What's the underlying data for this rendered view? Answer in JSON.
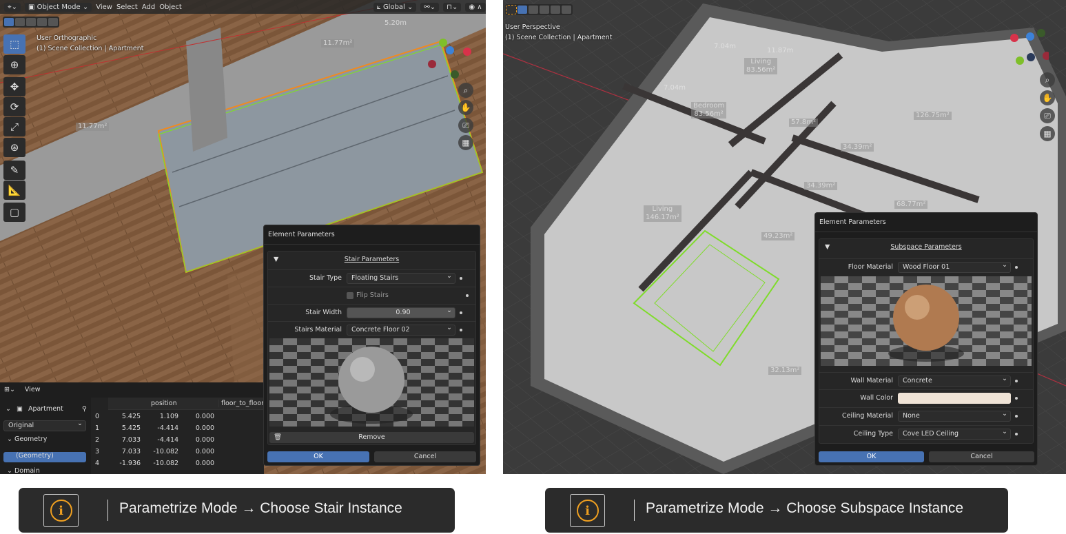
{
  "left": {
    "header": {
      "mode": "Object Mode",
      "menus": [
        "View",
        "Select",
        "Add",
        "Object"
      ],
      "orientation": "Global"
    },
    "viewport": {
      "view_name": "User Orthographic",
      "collection": "(1) Scene Collection | Apartment",
      "dim_labels": [
        "5.20m",
        "11.77m²",
        "11.77m²"
      ]
    },
    "dialog": {
      "title": "Element Parameters",
      "section": "Stair Parameters",
      "stair_type_label": "Stair Type",
      "stair_type": "Floating Stairs",
      "flip_label": "Flip Stairs",
      "flip_checked": false,
      "width_label": "Stair Width",
      "width": "0.90",
      "material_label": "Stairs Material",
      "material": "Concrete Floor 02",
      "remove": "Remove",
      "ok": "OK",
      "cancel": "Cancel"
    },
    "sheet": {
      "view": "View",
      "object": "Apartment",
      "mode": "Original",
      "geometry": "Geometry",
      "geometry_item": "(Geometry)",
      "domain": "Domain",
      "columns": [
        "position",
        "floor_to_floor_"
      ],
      "rows": [
        [
          "0",
          "5.425",
          "1.109",
          "0.000"
        ],
        [
          "1",
          "5.425",
          "-4.414",
          "0.000"
        ],
        [
          "2",
          "7.033",
          "-4.414",
          "0.000"
        ],
        [
          "3",
          "7.033",
          "-10.082",
          "0.000"
        ],
        [
          "4",
          "-1.936",
          "-10.082",
          "0.000"
        ]
      ]
    }
  },
  "right": {
    "viewport": {
      "view_name": "User Perspective",
      "collection": "(1) Scene Collection | Apartment",
      "rooms": [
        {
          "name": "Bedroom",
          "area": "83.56m²"
        },
        {
          "name": "Living",
          "area": "83.56m²"
        },
        {
          "name": "Living",
          "area": "146.17m²"
        }
      ],
      "areas": [
        "126.75m²",
        "57.8m²",
        "34.39m²",
        "34.39m²",
        "68.77m²",
        "49.23m²",
        "32.13m²"
      ],
      "dims": [
        "7.04m",
        "7.04m",
        "11.87m"
      ]
    },
    "dialog": {
      "title": "Element Parameters",
      "section": "Subspace Parameters",
      "floor_label": "Floor Material",
      "floor": "Wood Floor 01",
      "wall_label": "Wall Material",
      "wall": "Concrete",
      "wall_color_label": "Wall Color",
      "wall_color": "#efe3d6",
      "ceiling_label": "Ceiling Material",
      "ceiling": "None",
      "ceiling_type_label": "Ceiling Type",
      "ceiling_type": "Cove LED Ceiling",
      "ok": "OK",
      "cancel": "Cancel"
    }
  },
  "captions": [
    "Parametrize Mode → Choose Stair Instance",
    "Parametrize Mode → Choose Subspace Instance"
  ],
  "colors": {
    "accent": "#4772b3",
    "selection": "#7fdc2a",
    "info": "#f0a020"
  }
}
